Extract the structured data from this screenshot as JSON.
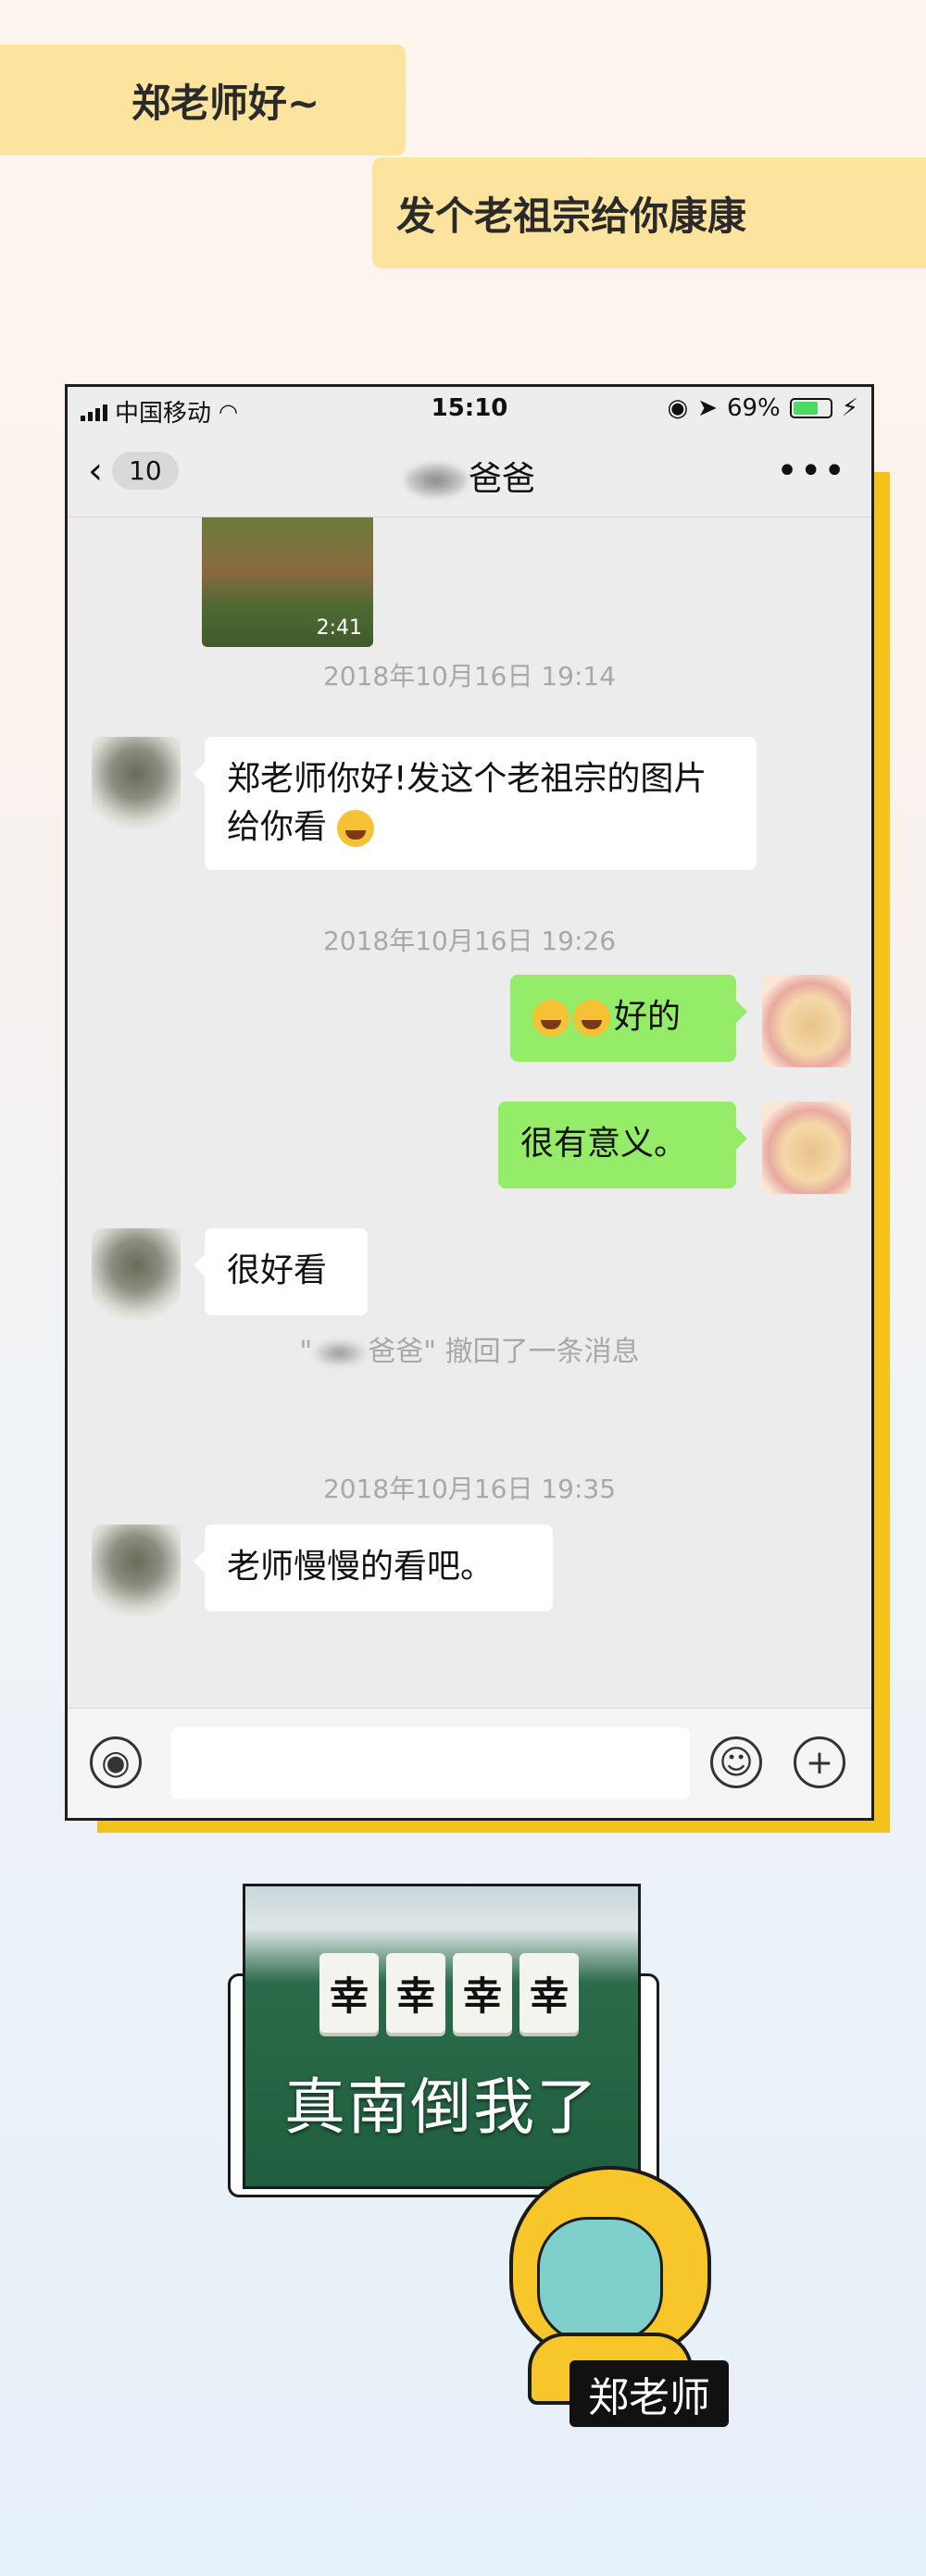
{
  "banners": {
    "line1": "郑老师好~",
    "line2": "发个老祖宗给你康康"
  },
  "status_bar": {
    "carrier": "中国移动",
    "time": "15:10",
    "battery": "69%",
    "battery_level": 0.69
  },
  "nav": {
    "back_count": "10",
    "title": "爸爸"
  },
  "chat": {
    "video_duration": "2:41",
    "ts1": "2018年10月16日 19:14",
    "msg1": "郑老师你好!发这个老祖宗的图片给你看",
    "ts2": "2018年10月16日 19:26",
    "msg2": "好的",
    "msg3": "很有意义。",
    "msg4": "很好看",
    "recall_prefix": "\"",
    "recall_text": "爸爸\" 撤回了一条消息",
    "ts3": "2018年10月16日 19:35",
    "msg5": "老师慢慢的看吧。"
  },
  "meme": {
    "tile_char": "幸",
    "caption": "真南倒我了",
    "nametag": "郑老师"
  },
  "colors": {
    "banner": "#fde49e",
    "accent_shadow": "#f5c21b",
    "bubble_out": "#95ec69"
  }
}
